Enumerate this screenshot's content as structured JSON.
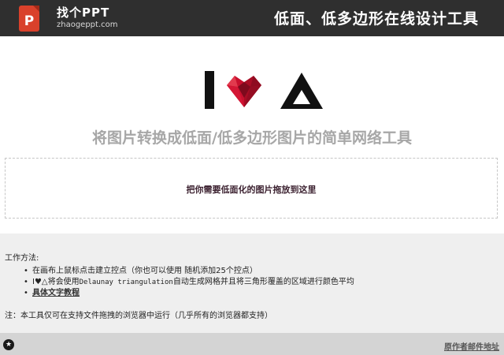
{
  "header": {
    "logo_name": "找个PPT",
    "logo_domain": "zhaogeppt.com",
    "title": "低面、低多边形在线设计工具"
  },
  "hero": {
    "letter": "I",
    "icon_names": [
      "low-poly-heart-icon",
      "triangle-icon"
    ],
    "colors": {
      "heart": "#c8102e",
      "heart_dark": "#7e0a1d",
      "ink": "#111111"
    }
  },
  "subtitle": "将图片转换成低面/低多边形图片的简单网络工具",
  "dropzone": {
    "text": "把你需要低面化的图片拖放到这里"
  },
  "info": {
    "method_label": "工作方法:",
    "step1": "在画布上鼠标点击建立控点（你也可以使用 随机添加25个控点）",
    "step2_prefix": "I♥△将会使用",
    "step2_mono": "Delaunay triangulation",
    "step2_suffix": "自动生成网格并且将三角形覆盖的区域进行颜色平均",
    "step3": "具体文字教程",
    "note": "注：本工具仅可在支持文件拖拽的浏览器中运行（几乎所有的浏览器都支持）"
  },
  "footer": {
    "star": "★",
    "author_link": "原作者邮件地址"
  }
}
